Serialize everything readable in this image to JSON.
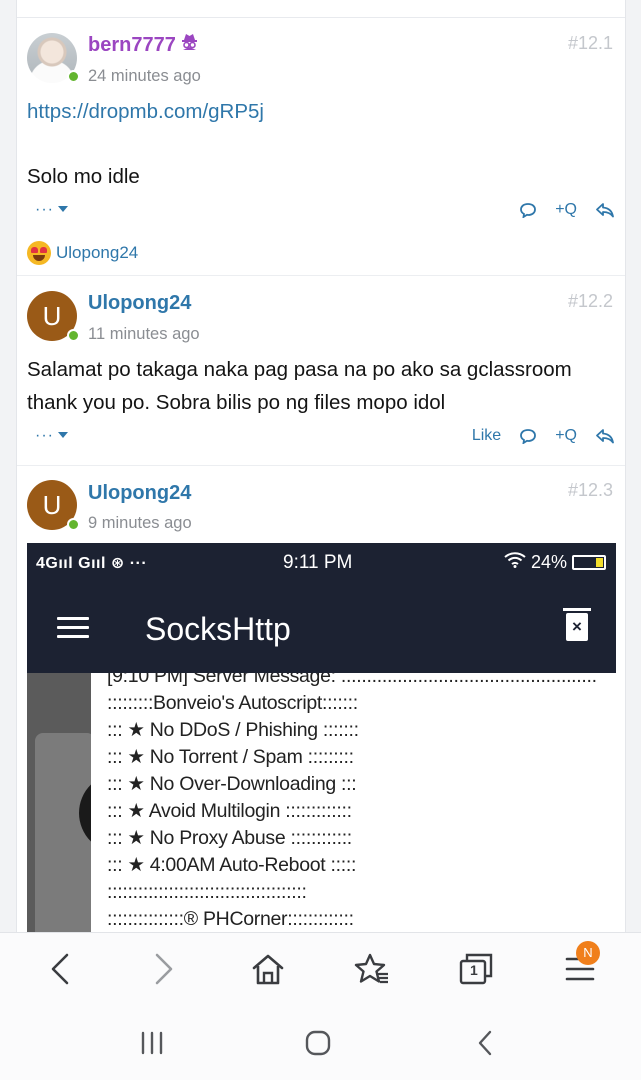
{
  "posts": [
    {
      "username": "bern7777",
      "badge_icon": "spy-icon",
      "time": "24 minutes ago",
      "number": "#12.1",
      "body_link": "https://dropmb.com/gRP5j",
      "body_text": "Solo mo idle",
      "reaction_user": "Ulopong24",
      "reaction_icon": "heart-eyes-emoji"
    },
    {
      "username": "Ulopong24",
      "avatar_letter": "U",
      "time": "11 minutes ago",
      "number": "#12.2",
      "body_line1": "Salamat po takaga naka pag pasa na po ako sa gclassroom",
      "body_line2": "thank you po. Sobra bilis po ng files mopo idol",
      "like_label": "Like"
    },
    {
      "username": "Ulopong24",
      "avatar_letter": "U",
      "time": "9 minutes ago",
      "number": "#12.3"
    }
  ],
  "actions": {
    "more_label": "···",
    "quote_label": "+Q"
  },
  "embed": {
    "status_left": "4Gııl Gııl ⊛ ···",
    "status_time": "9:11 PM",
    "battery": "24%",
    "app_title": "SocksHttp",
    "log_lines": [
      "[9:10 PM] Server Message: ..................................................",
      ":::::::::Bonveio's Autoscript:::::::",
      "::: ★ No DDoS / Phishing :::::::",
      "::: ★ No Torrent / Spam :::::::::",
      "::: ★ No Over-Downloading :::",
      "::: ★ Avoid Multilogin :::::::::::::",
      "::: ★ No Proxy Abuse ::::::::::::",
      "::: ★ 4:00AM Auto-Reboot :::::",
      ":::::::::::::::::::::::::::::::::::::::",
      ":::::::::::::::® PHCorner:::::::::::::"
    ]
  },
  "browser": {
    "tabs_count": "1",
    "menu_badge": "N"
  }
}
